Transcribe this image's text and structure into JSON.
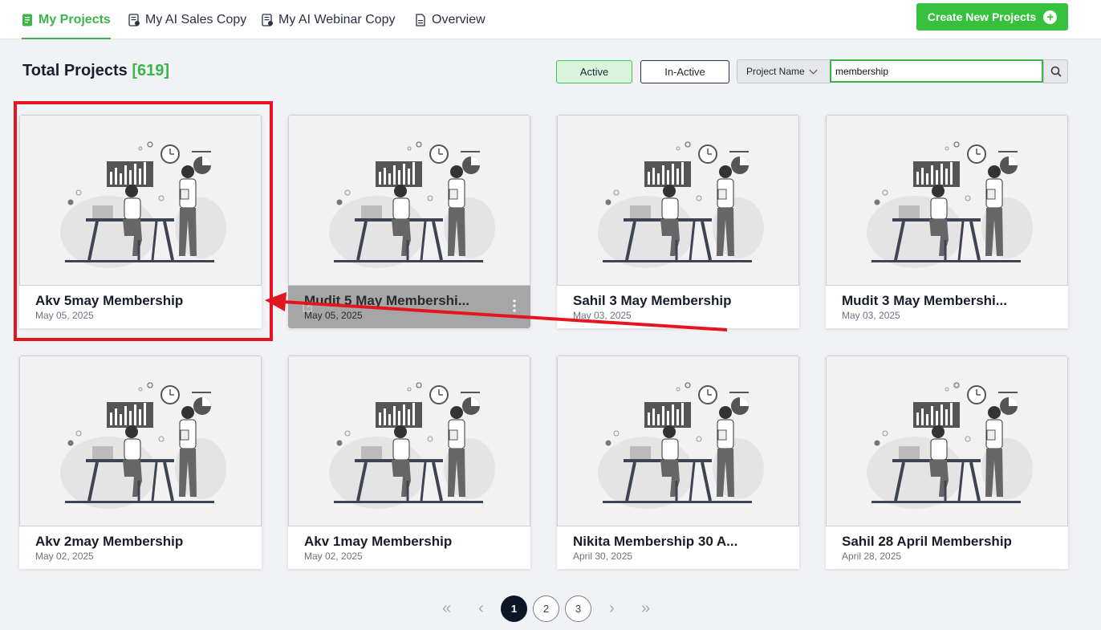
{
  "nav": {
    "tabs": [
      {
        "label": "My Projects",
        "icon": "document-icon",
        "active": true
      },
      {
        "label": "My AI Sales Copy",
        "icon": "sales-copy-icon",
        "active": false
      },
      {
        "label": "My AI Webinar Copy",
        "icon": "webinar-copy-icon",
        "active": false
      },
      {
        "label": "Overview",
        "icon": "overview-doc-icon",
        "active": false
      }
    ],
    "create_label": "Create New Projects"
  },
  "header": {
    "title": "Total Projects",
    "count": "[619]",
    "active_label": "Active",
    "inactive_label": "In-Active",
    "select_value": "Project Name",
    "search_value": "membership"
  },
  "projects": [
    {
      "title": "Akv 5may Membership",
      "date": "May 05, 2025"
    },
    {
      "title": "Mudit 5 May Membershi...",
      "date": "May 05, 2025"
    },
    {
      "title": "Sahil 3 May Membership",
      "date": "May 03, 2025"
    },
    {
      "title": "Mudit 3 May Membershi...",
      "date": "May 03, 2025"
    },
    {
      "title": "Akv 2may Membership",
      "date": "May 02, 2025"
    },
    {
      "title": "Akv 1may Membership",
      "date": "May 02, 2025"
    },
    {
      "title": "Nikita Membership 30 A...",
      "date": "April 30, 2025"
    },
    {
      "title": "Sahil 28 April Membership",
      "date": "April 28, 2025"
    }
  ],
  "pagination": {
    "first": "«",
    "prev": "‹",
    "pages": [
      "1",
      "2",
      "3"
    ],
    "current": "1",
    "next": "›",
    "last": "»"
  },
  "colors": {
    "accent": "#3bb54a",
    "create_button": "#35c13d",
    "annotation_red": "#e3161f",
    "current_page": "#0c1526"
  }
}
